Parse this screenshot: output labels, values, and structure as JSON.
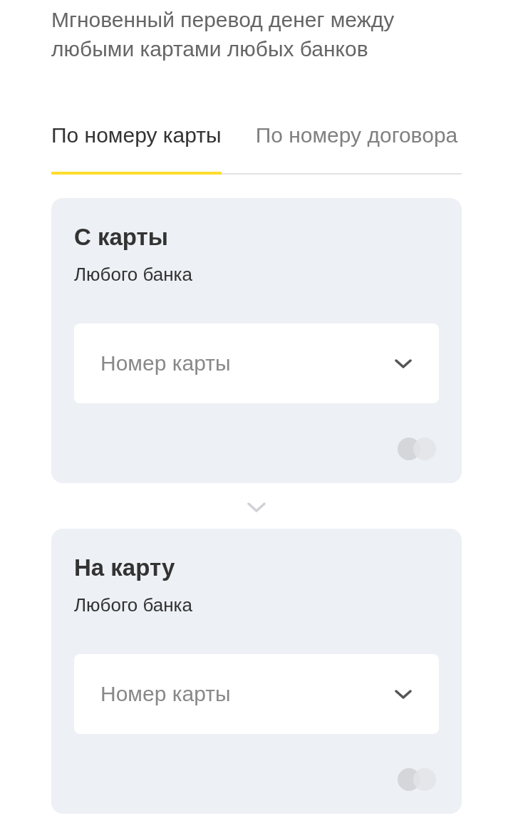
{
  "intro": "Мгновенный перевод денег между любыми картами любых банков",
  "tabs": [
    {
      "label": "По номеру карты",
      "selected": true
    },
    {
      "label": "По номеру договора",
      "selected": false
    }
  ],
  "cards": [
    {
      "title": "С карты",
      "subtitle": "Любого банка",
      "field": {
        "placeholder": "Номер карты"
      }
    },
    {
      "title": "На карту",
      "subtitle": "Любого банка",
      "field": {
        "placeholder": "Номер карты"
      }
    }
  ]
}
